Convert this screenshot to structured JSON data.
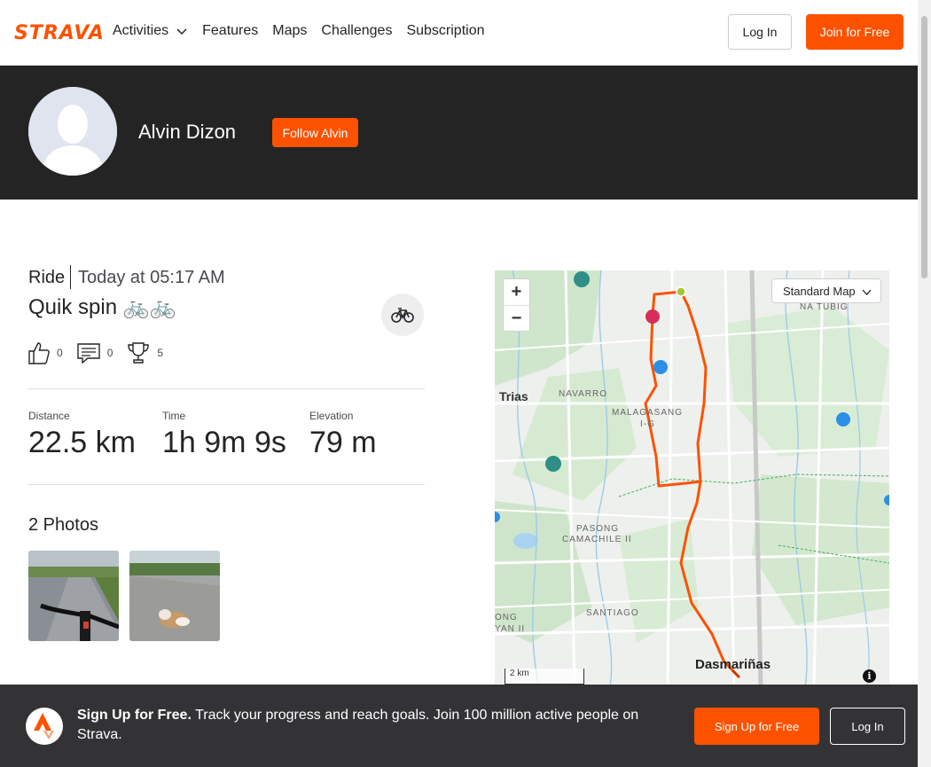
{
  "nav": {
    "logo": "STRAVA",
    "links": [
      "Activities",
      "Features",
      "Maps",
      "Challenges",
      "Subscription"
    ],
    "login": "Log In",
    "join": "Join for Free"
  },
  "athlete": {
    "name": "Alvin Dizon",
    "follow": "Follow Alvin"
  },
  "activity": {
    "type": "Ride",
    "date": "Today at 05:17 AM",
    "title": "Quik spin 🚲🚲",
    "kudos": "0",
    "comments": "0",
    "achievements": "5"
  },
  "stats": [
    {
      "label": "Distance",
      "value": "22.5 km"
    },
    {
      "label": "Time",
      "value": "1h 9m 9s"
    },
    {
      "label": "Elevation",
      "value": "79 m"
    }
  ],
  "photos": {
    "title": "2 Photos"
  },
  "map": {
    "select": "Standard Map",
    "scale": "2 km",
    "zoom_in": "+",
    "zoom_out": "−",
    "info": "i",
    "labels": {
      "trias": "Trias",
      "navarro": "NAVARRO",
      "malagasang": "MALAGASANG",
      "ig": "I-G",
      "pasong": "PASONG",
      "camachile": "CAMACHILE II",
      "santiago": "SANTIAGO",
      "ong": "ONG",
      "yan": "YAN II",
      "natubig": "NA TUBIG",
      "dasmarinas": "Dasmariñas"
    }
  },
  "banner": {
    "bold": "Sign Up for Free.",
    "text": " Track your progress and reach goals. Join 100 million active people on Strava.",
    "signup": "Sign Up for Free",
    "login": "Log In"
  },
  "colors": {
    "accent": "#fc5200",
    "header_band": "#242424",
    "banner": "#333336"
  }
}
